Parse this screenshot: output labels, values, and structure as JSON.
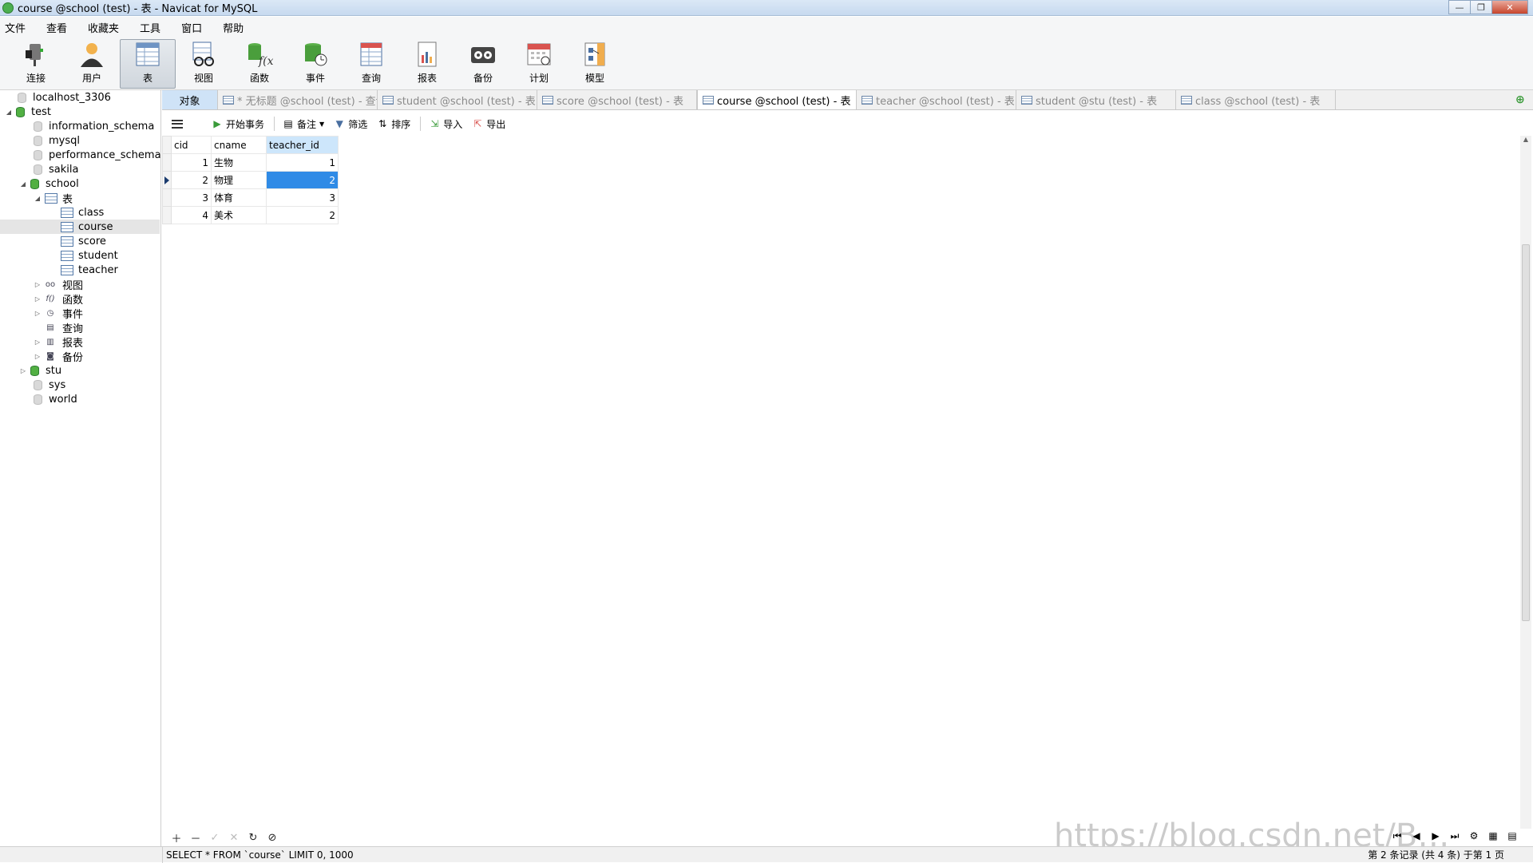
{
  "window": {
    "title": "course @school (test) - 表 - Navicat for MySQL",
    "min": "—",
    "max": "❐",
    "close": "✕"
  },
  "menu": [
    "文件",
    "查看",
    "收藏夹",
    "工具",
    "窗口",
    "帮助"
  ],
  "toolbar": [
    {
      "label": "连接",
      "icon": "plug-icon"
    },
    {
      "label": "用户",
      "icon": "user-icon"
    },
    {
      "label": "表",
      "icon": "table-icon",
      "active": true
    },
    {
      "label": "视图",
      "icon": "view-icon"
    },
    {
      "label": "函数",
      "icon": "function-icon"
    },
    {
      "label": "事件",
      "icon": "event-icon"
    },
    {
      "label": "查询",
      "icon": "query-icon"
    },
    {
      "label": "报表",
      "icon": "report-icon"
    },
    {
      "label": "备份",
      "icon": "backup-icon"
    },
    {
      "label": "计划",
      "icon": "schedule-icon"
    },
    {
      "label": "模型",
      "icon": "model-icon"
    }
  ],
  "tree": {
    "connection": "localhost_3306",
    "test": "test",
    "dbs_top": [
      "information_schema",
      "mysql",
      "performance_schema",
      "sakila"
    ],
    "school": "school",
    "tables_node": "表",
    "tables": [
      "class",
      "course",
      "score",
      "student",
      "teacher"
    ],
    "others": [
      "视图",
      "函数",
      "事件",
      "查询",
      "报表",
      "备份"
    ],
    "dbs_bottom": [
      "stu",
      "sys",
      "world"
    ]
  },
  "tabs": {
    "objects": "对象",
    "items": [
      "* 无标题 @school (test) - 查询",
      "student @school (test) - 表",
      "score @school (test) - 表",
      "course @school (test) - 表",
      "teacher @school (test) - 表",
      "student @stu (test) - 表",
      "class @school (test) - 表"
    ],
    "active_index": 3
  },
  "data_toolbar": {
    "begin_tx": "开始事务",
    "note": "备注",
    "filter": "筛选",
    "sort": "排序",
    "import": "导入",
    "export": "导出"
  },
  "grid": {
    "columns": [
      "cid",
      "cname",
      "teacher_id"
    ],
    "rows": [
      [
        "1",
        "生物",
        "1"
      ],
      [
        "2",
        "物理",
        "2"
      ],
      [
        "3",
        "体育",
        "3"
      ],
      [
        "4",
        "美术",
        "2"
      ]
    ],
    "selected_row": 1,
    "selected_col": 2
  },
  "status": {
    "sql": "SELECT * FROM `course` LIMIT 0, 1000",
    "records": "第 2 条记录 (共 4 条) 于第 1 页"
  },
  "watermark": "https://blog.csdn.net/B…"
}
